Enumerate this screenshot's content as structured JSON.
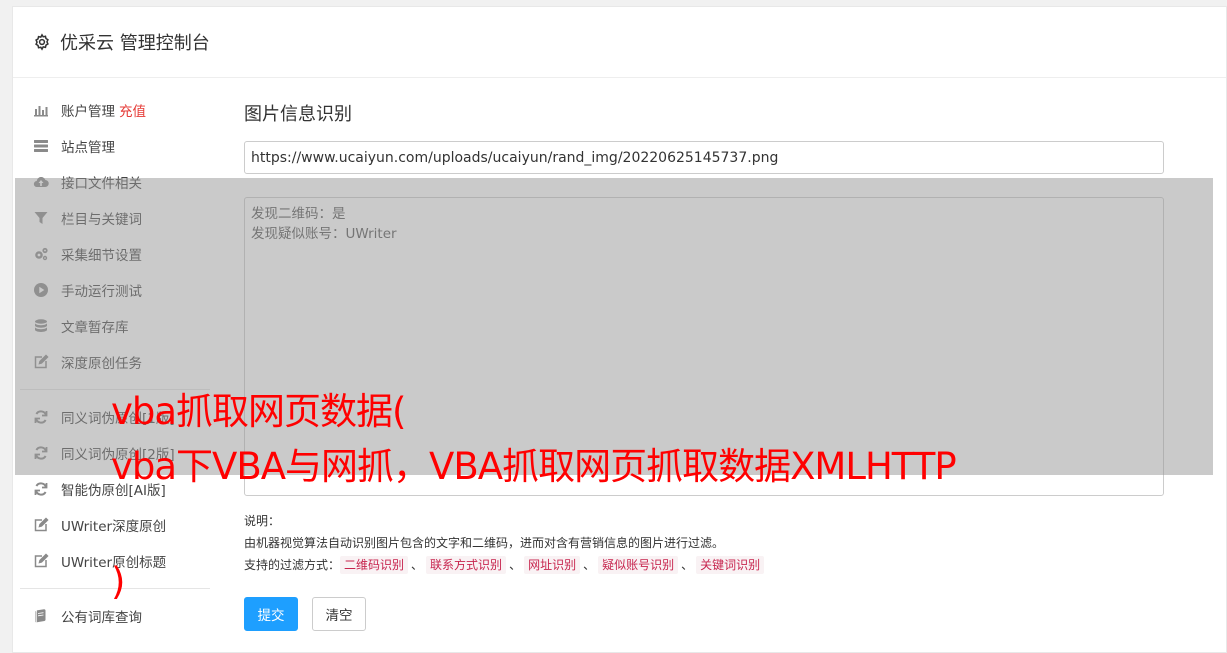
{
  "header": {
    "title": "优采云 管理控制台"
  },
  "sidebar": {
    "group1": [
      {
        "icon": "bar-chart-icon",
        "label": "账户管理",
        "badge": "充值"
      },
      {
        "icon": "server-icon",
        "label": "站点管理"
      },
      {
        "icon": "cloud-upload-icon",
        "label": "接口文件相关"
      },
      {
        "icon": "filter-icon",
        "label": "栏目与关键词"
      },
      {
        "icon": "cogs-icon",
        "label": "采集细节设置"
      },
      {
        "icon": "play-circle-icon",
        "label": "手动运行测试"
      },
      {
        "icon": "database-icon",
        "label": "文章暂存库"
      },
      {
        "icon": "edit-icon",
        "label": "深度原创任务"
      }
    ],
    "group2": [
      {
        "icon": "refresh-icon",
        "label": "同义词伪原创[1版]"
      },
      {
        "icon": "refresh-icon",
        "label": "同义词伪原创[2版]"
      },
      {
        "icon": "refresh-icon",
        "label": "智能伪原创[AI版]"
      },
      {
        "icon": "edit-icon",
        "label": "UWriter深度原创"
      },
      {
        "icon": "edit-icon",
        "label": "UWriter原创标题"
      }
    ],
    "group3": [
      {
        "icon": "book-icon",
        "label": "公有词库查询"
      }
    ]
  },
  "main": {
    "heading": "图片信息识别",
    "url_value": "https://www.ucaiyun.com/uploads/ucaiyun/rand_img/20220625145737.png",
    "result_lines": [
      "发现二维码：是",
      "发现疑似账号：UWriter"
    ],
    "notes": {
      "label": "说明：",
      "desc": "由机器视觉算法自动识别图片包含的文字和二维码，进而对含有营销信息的图片进行过滤。",
      "filters_label": "支持的过滤方式：",
      "separator": "、",
      "filters": [
        "二维码识别",
        "联系方式识别",
        "网址识别",
        "疑似账号识别",
        "关键词识别"
      ]
    },
    "submit_label": "提交",
    "clear_label": "清空"
  },
  "overlay": {
    "line1": "vba抓取网页数据(",
    "line2": "vba下VBA与网抓，VBA抓取网页抓取数据XMLHTTP",
    "line3": ")"
  },
  "colors": {
    "accent": "#1e9fff",
    "badge_red": "#e53935",
    "overlay_text": "#ff0000",
    "tag_bg": "#f9f2f4",
    "tag_text": "#c7254e"
  }
}
